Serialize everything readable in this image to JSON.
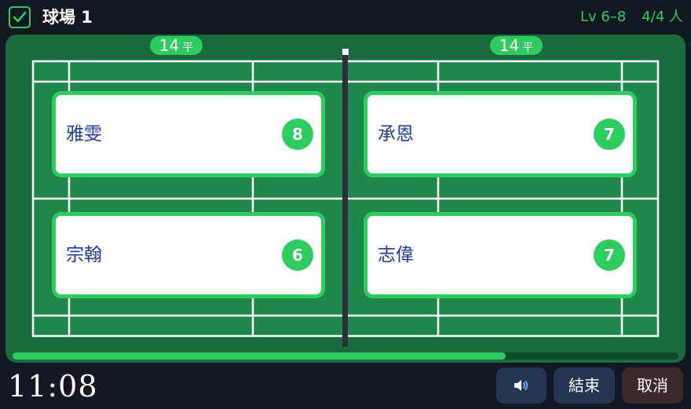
{
  "header": {
    "title": "球場 1",
    "level": "Lv 6–8",
    "players": "4/4 人"
  },
  "scores": {
    "left": {
      "value": "14",
      "unit": "平"
    },
    "right": {
      "value": "14",
      "unit": "平"
    }
  },
  "players": [
    {
      "name": "雅雯",
      "level": "8"
    },
    {
      "name": "承恩",
      "level": "7"
    },
    {
      "name": "宗翰",
      "level": "6"
    },
    {
      "name": "志偉",
      "level": "7"
    }
  ],
  "progress": {
    "fraction": 0.74
  },
  "footer": {
    "timer": "11:08",
    "end_label": "結束",
    "cancel_label": "取消"
  },
  "colors": {
    "accent": "#2ecc5f",
    "court": "#176b3c",
    "name_text": "#1e3a9e",
    "background": "#121821"
  },
  "icons": {
    "checkbox": "check-square-icon",
    "sound": "speaker-icon"
  }
}
